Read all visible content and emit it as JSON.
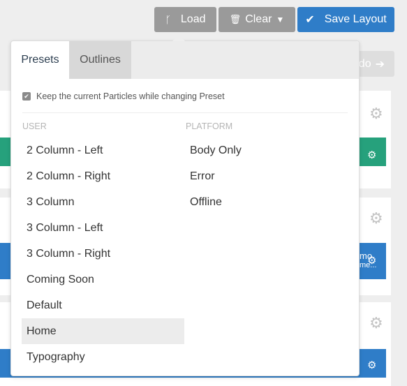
{
  "toolbar": {
    "load_label": "Load",
    "clear_label": "Clear",
    "save_label": "Save Layout",
    "redo_label": "do"
  },
  "popover": {
    "tabs": [
      {
        "label": "Presets",
        "active": true
      },
      {
        "label": "Outlines",
        "active": false
      }
    ],
    "keep_particles": {
      "label": "Keep the current Particles while changing Preset",
      "checked": true
    },
    "user_heading": "USER",
    "platform_heading": "PLATFORM",
    "user_presets": [
      "2 Column - Left",
      "2 Column - Right",
      "3 Column",
      "3 Column - Left",
      "3 Column - Right",
      "Coming Soon",
      "Default",
      "Home",
      "Typography"
    ],
    "selected_preset": "Home",
    "platform_presets": [
      "Body Only",
      "Error",
      "Offline"
    ]
  },
  "background": {
    "bar2_text1": "mo",
    "bar2_text2": "me..."
  },
  "colors": {
    "primary": "#2f7dc8",
    "green": "#26a17c",
    "button_gray": "#9a9a9a"
  }
}
